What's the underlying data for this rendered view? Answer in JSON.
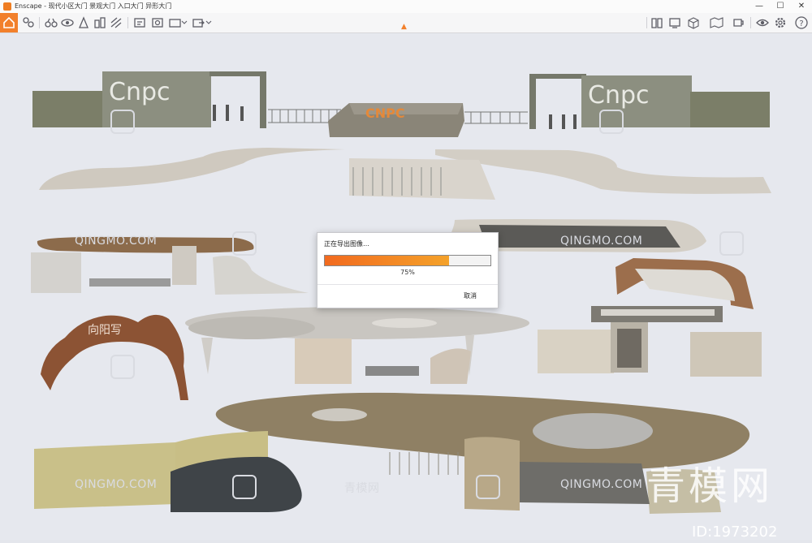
{
  "window": {
    "title": "Enscape - 现代小区大门 景观大门 入口大门 异形大门",
    "min_label": "—",
    "max_label": "☐",
    "close_label": "✕"
  },
  "toolbar": {
    "left_icons": [
      "home-icon",
      "asset-library-icon",
      "binoculars-icon",
      "layers-icon",
      "lightbulb-icon",
      "buildings-icon",
      "texture-icon",
      "render-image-icon",
      "panorama-icon",
      "video-path-icon",
      "export-icon"
    ],
    "right_icons": [
      "book-icon",
      "monitor-icon",
      "cube-icon",
      "map-icon",
      "mask-icon",
      "cup-icon",
      "eye-icon",
      "gear-icon",
      "help-icon"
    ],
    "accent_color": "#f2802c"
  },
  "scene": {
    "sign_left": "Cnpc",
    "sign_right": "Cnpc",
    "sign_center": "CNPC",
    "arch_sign": "向阳写"
  },
  "watermarks": {
    "repeat_text": "QINGMO.COM",
    "cn_text": "青模网",
    "big_cn": "青模网",
    "id_text": "ID:1973202"
  },
  "dialog": {
    "title": "正在导出图像…",
    "progress": 0.75,
    "progress_text": "75%",
    "cancel_label": "取消"
  }
}
